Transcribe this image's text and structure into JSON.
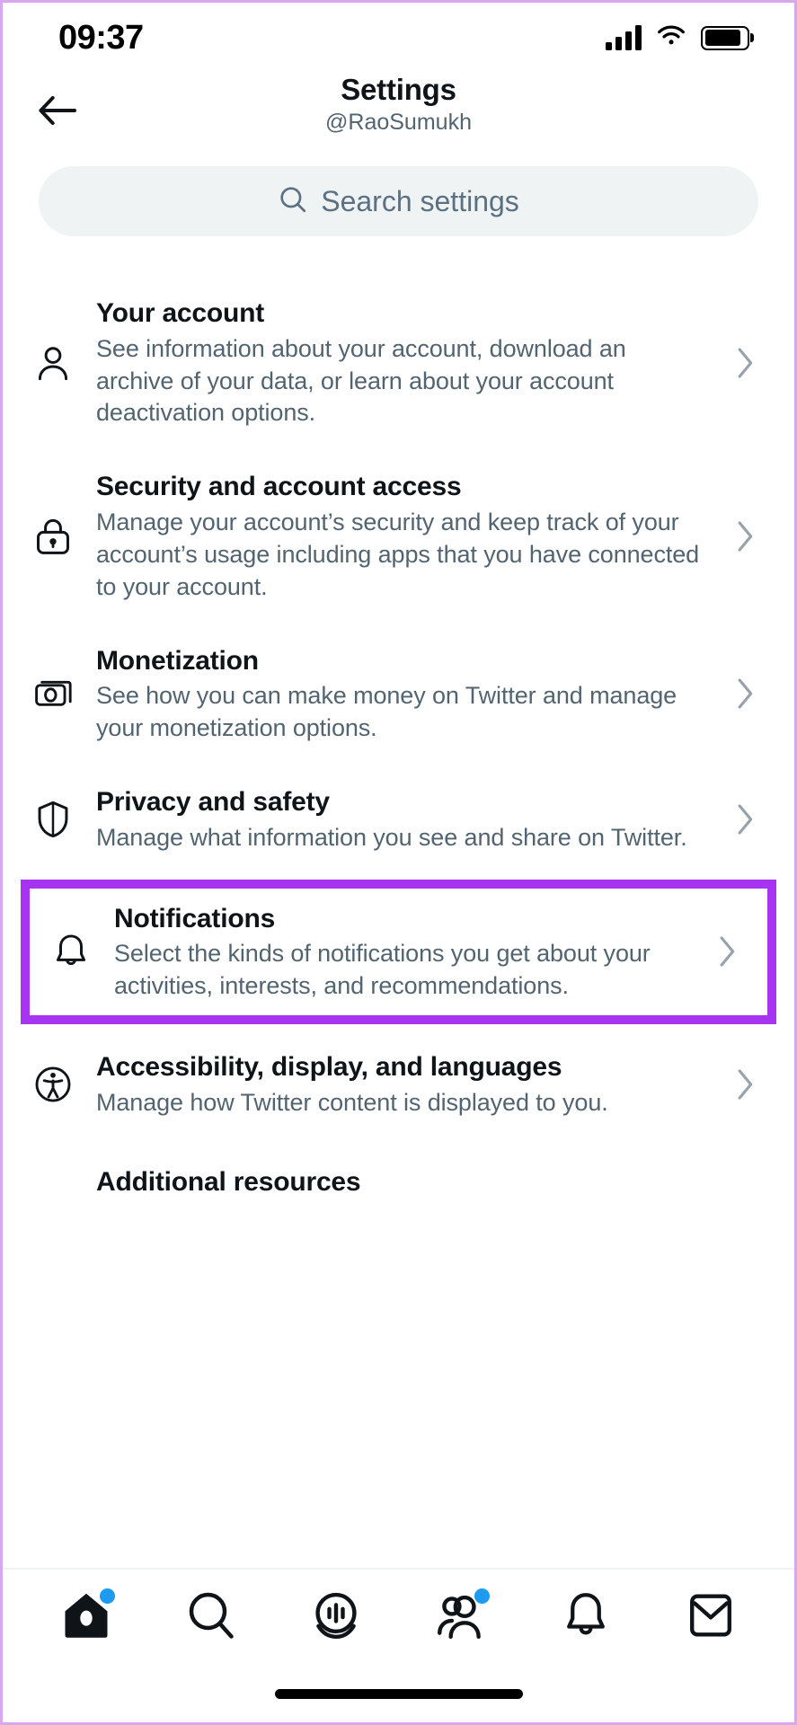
{
  "status_bar": {
    "time": "09:37",
    "signal_icon": "cellular-signal-icon",
    "wifi_icon": "wifi-icon",
    "battery_icon": "battery-icon"
  },
  "header": {
    "back_icon": "back-arrow-icon",
    "title": "Settings",
    "handle": "@RaoSumukh"
  },
  "search": {
    "icon": "search-icon",
    "placeholder": "Search settings",
    "value": ""
  },
  "colors": {
    "highlight": "#A734F0",
    "accent": "#1D9BF0",
    "text_primary": "#0F1419",
    "text_secondary": "#536471",
    "search_bg": "#EFF3F4"
  },
  "settings_items": [
    {
      "icon": "person-icon",
      "title": "Your account",
      "description": "See information about your account, download an archive of your data, or learn about your account deactivation options.",
      "highlighted": false,
      "chevron": "chevron-right-icon"
    },
    {
      "icon": "lock-icon",
      "title": "Security and account access",
      "description": "Manage your account’s security and keep track of your account’s usage including apps that you have connected to your account.",
      "highlighted": false,
      "chevron": "chevron-right-icon"
    },
    {
      "icon": "money-icon",
      "title": "Monetization",
      "description": "See how you can make money on Twitter and manage your monetization options.",
      "highlighted": false,
      "chevron": "chevron-right-icon"
    },
    {
      "icon": "shield-icon",
      "title": "Privacy and safety",
      "description": "Manage what information you see and share on Twitter.",
      "highlighted": false,
      "chevron": "chevron-right-icon"
    },
    {
      "icon": "bell-icon",
      "title": "Notifications",
      "description": "Select the kinds of notifications you get about your activities, interests, and recommendations.",
      "highlighted": true,
      "chevron": "chevron-right-icon"
    },
    {
      "icon": "accessibility-icon",
      "title": "Accessibility, display, and languages",
      "description": "Manage how Twitter content is displayed to you.",
      "highlighted": false,
      "chevron": "chevron-right-icon"
    },
    {
      "icon": "",
      "title": "Additional resources",
      "description": "",
      "highlighted": false,
      "chevron": ""
    }
  ],
  "bottom_nav": [
    {
      "icon": "home-icon",
      "label": "Home",
      "badge": true,
      "active": true
    },
    {
      "icon": "search-icon",
      "label": "Search",
      "badge": false,
      "active": false
    },
    {
      "icon": "spaces-icon",
      "label": "Spaces",
      "badge": false,
      "active": false
    },
    {
      "icon": "communities-icon",
      "label": "Communities",
      "badge": true,
      "active": false
    },
    {
      "icon": "bell-icon",
      "label": "Notifications",
      "badge": false,
      "active": false
    },
    {
      "icon": "mail-icon",
      "label": "Messages",
      "badge": false,
      "active": false
    }
  ]
}
